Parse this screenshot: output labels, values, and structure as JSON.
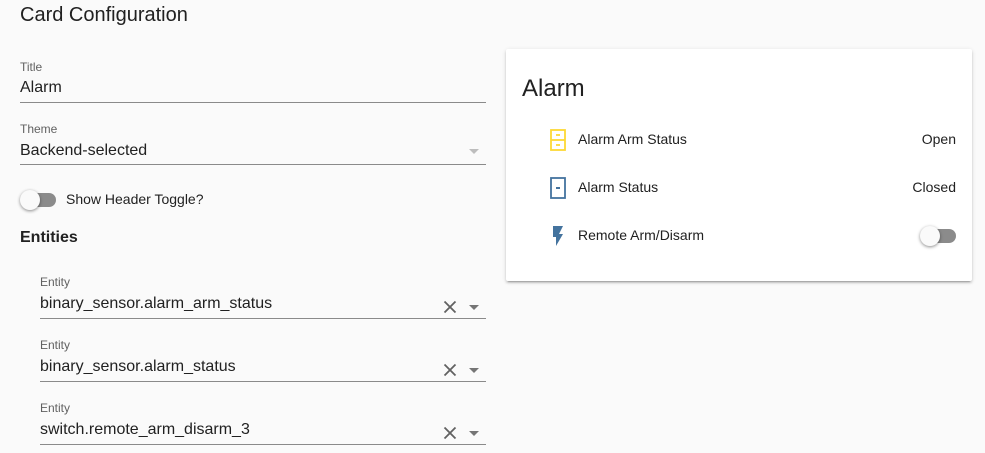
{
  "heading": "Card Configuration",
  "form": {
    "title": {
      "label": "Title",
      "value": "Alarm"
    },
    "theme": {
      "label": "Theme",
      "value": "Backend-selected"
    },
    "show_header_toggle": {
      "label": "Show Header Toggle?",
      "checked": false
    },
    "entities_heading": "Entities",
    "entities": [
      {
        "label": "Entity",
        "value": "binary_sensor.alarm_arm_status"
      },
      {
        "label": "Entity",
        "value": "binary_sensor.alarm_status"
      },
      {
        "label": "Entity",
        "value": "switch.remote_arm_disarm_3"
      }
    ]
  },
  "preview": {
    "title": "Alarm",
    "rows": [
      {
        "name": "Alarm Arm Status",
        "state": "Open",
        "icon": "door-open-icon",
        "icon_color": "#fdd835"
      },
      {
        "name": "Alarm Status",
        "state": "Closed",
        "icon": "door-closed-icon",
        "icon_color": "#44739e"
      },
      {
        "name": "Remote Arm/Disarm",
        "state": "",
        "icon": "flash-icon",
        "icon_color": "#44739e",
        "toggle": false
      }
    ]
  },
  "colors": {
    "background": "#fafafa",
    "card": "#ffffff",
    "on_icon": "#fdd835",
    "off_icon": "#44739e"
  }
}
